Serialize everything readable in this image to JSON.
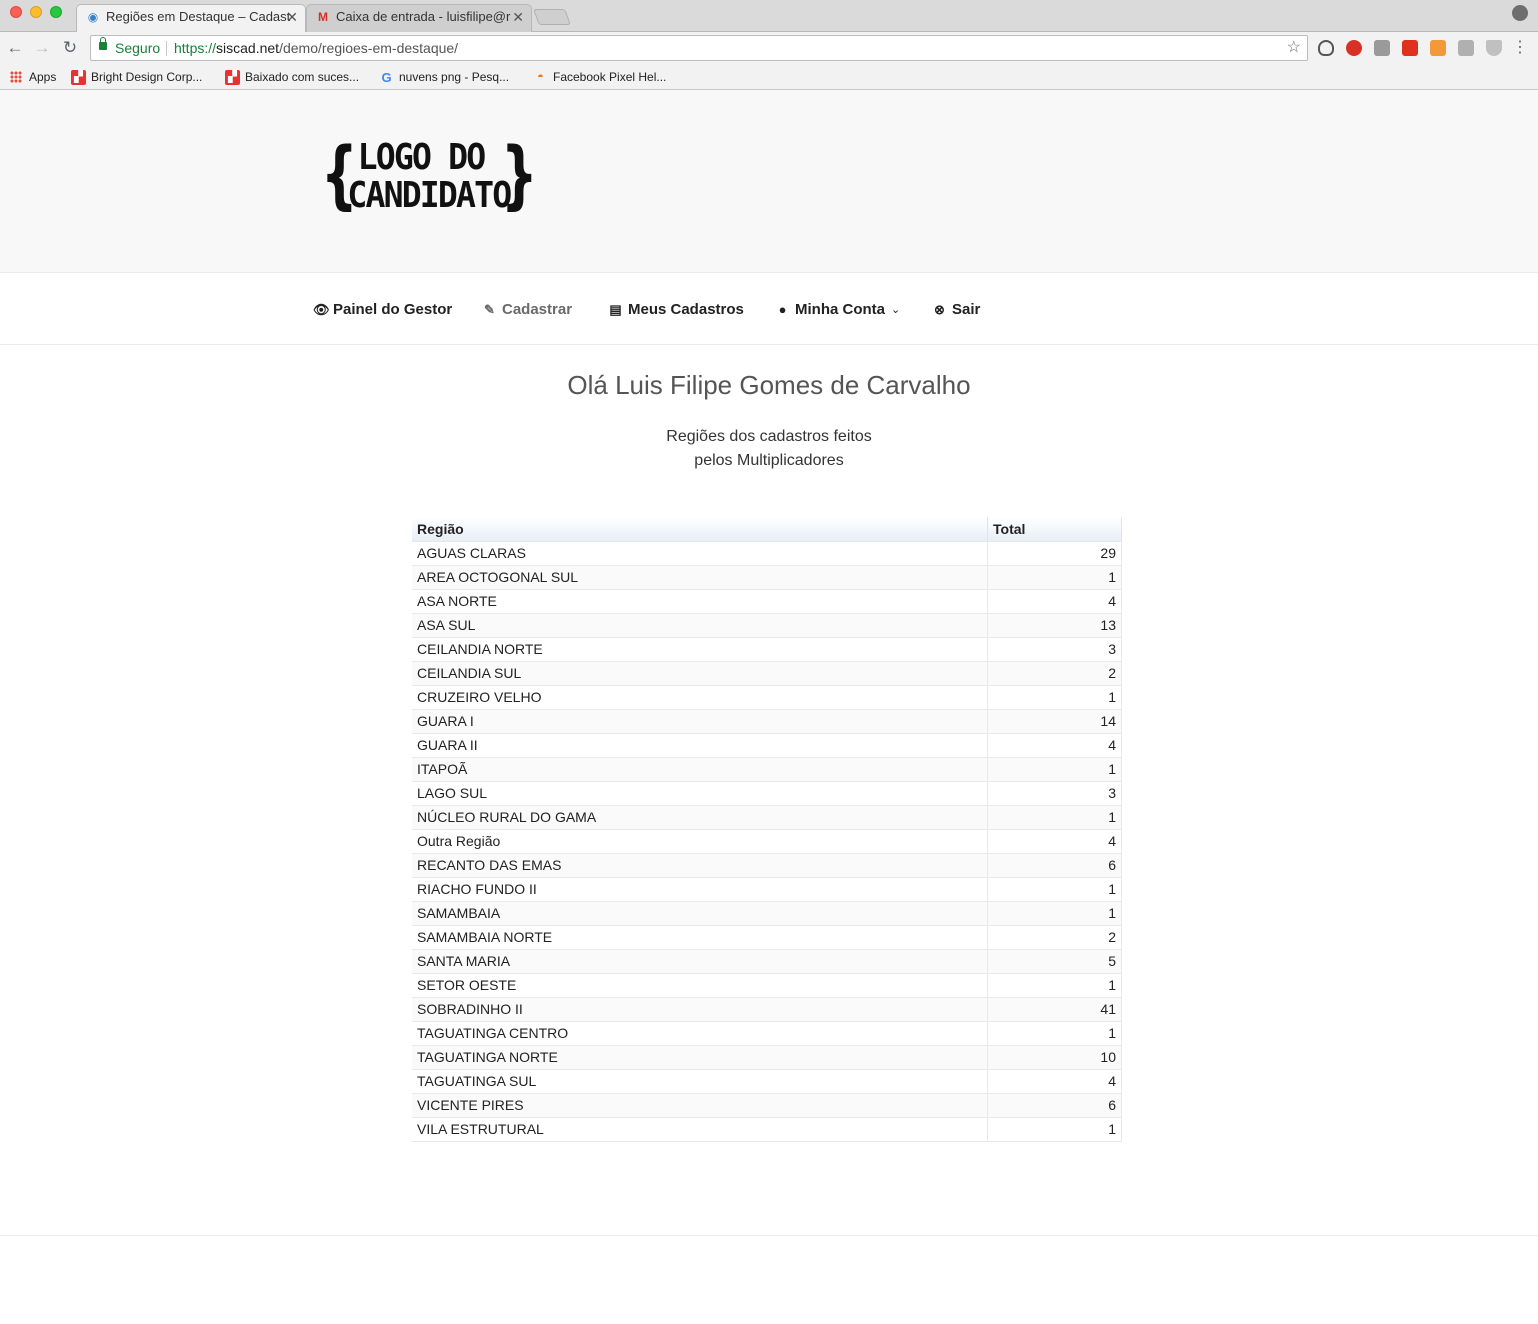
{
  "browser": {
    "tabs": [
      {
        "title": "Regiões em Destaque – Cadast",
        "active": true
      },
      {
        "title": "Caixa de entrada - luisfilipe@r",
        "active": false
      }
    ],
    "omnibox": {
      "secure_label": "Seguro",
      "scheme": "https://",
      "host": "siscad.net",
      "path": "/demo/regioes-em-destaque/"
    },
    "bookmarks": [
      {
        "label": "Apps",
        "icon": "apps-grid-icon"
      },
      {
        "label": "Bright Design Corp...",
        "icon": "bright-design-favicon"
      },
      {
        "label": "Baixado com suces...",
        "icon": "baixado-favicon"
      },
      {
        "label": "nuvens png - Pesq...",
        "icon": "google-g-icon"
      },
      {
        "label": "Facebook Pixel Hel...",
        "icon": "pixel-helper-icon"
      }
    ],
    "colors": {
      "secure_green": "#188038"
    }
  },
  "site": {
    "logo": {
      "line1": "LOGO DO",
      "line2": "CANDIDATO"
    },
    "nav": [
      {
        "label": "Painel do Gestor",
        "icon": "eye-icon"
      },
      {
        "label": "Cadastrar",
        "icon": "edit-icon"
      },
      {
        "label": "Meus Cadastros",
        "icon": "document-icon"
      },
      {
        "label": "Minha Conta",
        "icon": "user-icon"
      },
      {
        "label": "Sair",
        "icon": "close-circle-icon"
      }
    ],
    "greeting": "Olá Luis Filipe Gomes de Carvalho",
    "subtitle_line1": "Regiões dos cadastros feitos",
    "subtitle_line2": "pelos Multiplicadores"
  },
  "table": {
    "headers": [
      "Região",
      "Total"
    ],
    "rows": [
      [
        "AGUAS CLARAS",
        "29"
      ],
      [
        "AREA OCTOGONAL SUL",
        "1"
      ],
      [
        "ASA NORTE",
        "4"
      ],
      [
        "ASA SUL",
        "13"
      ],
      [
        "CEILANDIA NORTE",
        "3"
      ],
      [
        "CEILANDIA SUL",
        "2"
      ],
      [
        "CRUZEIRO VELHO",
        "1"
      ],
      [
        "GUARA I",
        "14"
      ],
      [
        "GUARA II",
        "4"
      ],
      [
        "ITAPOÃ",
        "1"
      ],
      [
        "LAGO SUL",
        "3"
      ],
      [
        "NÚCLEO RURAL DO GAMA",
        "1"
      ],
      [
        "Outra Região",
        "4"
      ],
      [
        "RECANTO DAS EMAS",
        "6"
      ],
      [
        "RIACHO FUNDO II",
        "1"
      ],
      [
        "SAMAMBAIA",
        "1"
      ],
      [
        "SAMAMBAIA NORTE",
        "2"
      ],
      [
        "SANTA MARIA",
        "5"
      ],
      [
        "SETOR OESTE",
        "1"
      ],
      [
        "SOBRADINHO II",
        "41"
      ],
      [
        "TAGUATINGA CENTRO",
        "1"
      ],
      [
        "TAGUATINGA NORTE",
        "10"
      ],
      [
        "TAGUATINGA SUL",
        "4"
      ],
      [
        "VICENTE PIRES",
        "6"
      ],
      [
        "VILA ESTRUTURAL",
        "1"
      ]
    ]
  }
}
